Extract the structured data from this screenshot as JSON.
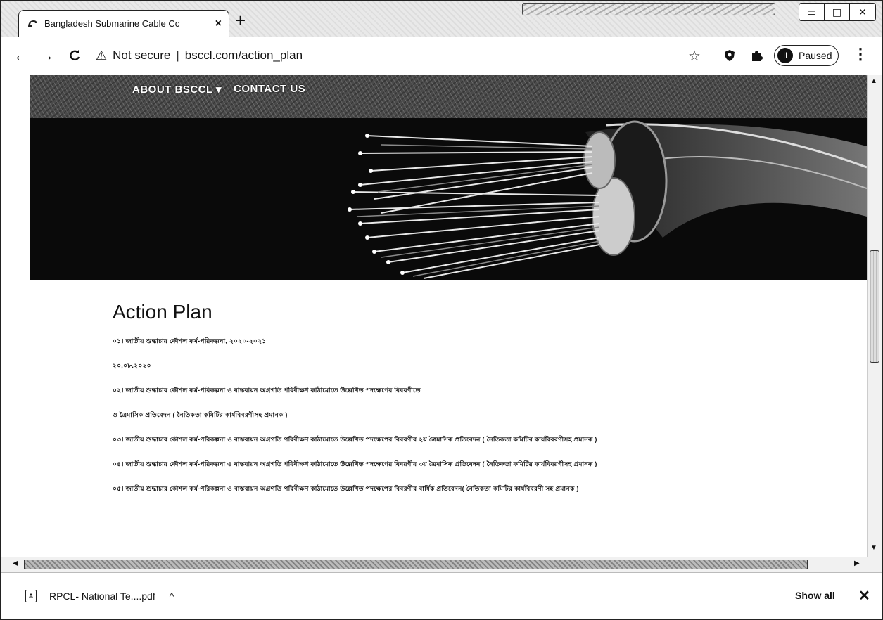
{
  "browser": {
    "tab_title": "Bangladesh Submarine Cable Cc",
    "tab_close_glyph": "×",
    "new_tab_glyph": "+",
    "address_security": "Not secure",
    "address_url": "bsccl.com/action_plan",
    "profile_status": "Paused",
    "window_controls": {
      "minimize": "▭",
      "restore": "◰",
      "close": "✕"
    }
  },
  "site_nav": {
    "items": [
      {
        "label": "ABOUT BSCCL ▾"
      },
      {
        "label": "CONTACT US"
      }
    ]
  },
  "main": {
    "title": "Action Plan",
    "documents": [
      {
        "label": "০১। জাতীয় শুদ্ধাচার কৌশল কর্ম-পরিকল্পনা, ২০২০-২০২১"
      },
      {
        "label": "২০,০৮.২০২০"
      },
      {
        "label": "০২। জাতীয় শুদ্ধাচার কৌশল কর্ম-পরিকল্পনা ও বাস্তবায়ন অগ্রগতি পরিবীক্ষণ কাঠামোতে উল্লেখিত পদক্ষেপের বিবরণীতে"
      },
      {
        "label": "ও ত্রৈমাসিক প্রতিবেদন ( নৈতিকতা কমিটির কার্যবিবরণীসহ প্রমানক )"
      },
      {
        "label": "০৩। জাতীয় শুদ্ধাচার কৌশল কর্ম-পরিকল্পনা ও বাস্তবায়ন অগ্রগতি পরিবীক্ষণ কাঠামোতে উল্লেখিত পদক্ষেপের বিবরণীর ২য় ত্রৈমাসিক প্রতিবেদন ( নৈতিকতা কমিটির কার্যবিবরণীসহ প্রমানক )"
      },
      {
        "label": "০৪। জাতীয় শুদ্ধাচার কৌশল কর্ম-পরিকল্পনা ও বাস্তবায়ন অগ্রগতি পরিবীক্ষণ কাঠামোতে উল্লেখিত পদক্ষেপের বিবরণীর ৩য় ত্রৈমাসিক প্রতিবেদন ( নৈতিকতা কমিটির কার্যবিবরণীসহ প্রমানক )"
      },
      {
        "label": "০৫। জাতীয় শুদ্ধাচার কৌশল কর্ম-পরিকল্পনা ও বাস্তবায়ন অগ্রগতি পরিবীক্ষণ কাঠামোতে উল্লেখিত পদক্ষেপের বিবরণীর বার্ষিক প্রতিবেদন( নৈতিকতা কমিটির কার্যবিবরণী সহ প্রমানক )"
      }
    ]
  },
  "downloads": {
    "file_name": "RPCL- National Te....pdf",
    "show_all_label": "Show all",
    "close_glyph": "✕"
  },
  "colors": {
    "hero_background": "#0a0a0a",
    "nav_background": "#4a4a4a"
  }
}
